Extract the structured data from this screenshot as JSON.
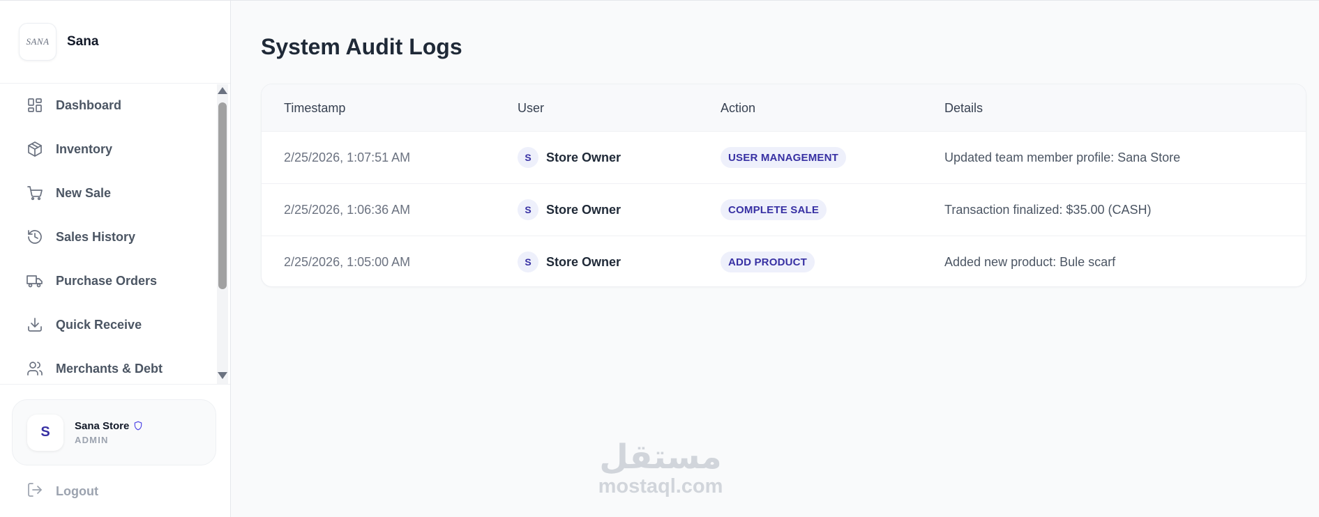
{
  "brand": {
    "name": "Sana",
    "logo_text": "SANA"
  },
  "sidebar": {
    "items": [
      {
        "label": "Dashboard",
        "icon": "grid-icon"
      },
      {
        "label": "Inventory",
        "icon": "box-icon"
      },
      {
        "label": "New Sale",
        "icon": "cart-icon"
      },
      {
        "label": "Sales History",
        "icon": "history-icon"
      },
      {
        "label": "Purchase Orders",
        "icon": "truck-icon"
      },
      {
        "label": "Quick Receive",
        "icon": "download-icon"
      },
      {
        "label": "Merchants & Debt",
        "icon": "users-icon"
      }
    ],
    "user": {
      "initial": "S",
      "name": "Sana Store",
      "role": "ADMIN",
      "badge_icon": "shield-icon"
    },
    "logout_label": "Logout"
  },
  "main": {
    "title": "System Audit Logs",
    "table": {
      "headers": [
        "Timestamp",
        "User",
        "Action",
        "Details"
      ],
      "rows": [
        {
          "timestamp": "2/25/2026, 1:07:51 AM",
          "user_initial": "S",
          "user": "Store Owner",
          "action": "USER MANAGEMENT",
          "details": "Updated team member profile: Sana Store"
        },
        {
          "timestamp": "2/25/2026, 1:06:36 AM",
          "user_initial": "S",
          "user": "Store Owner",
          "action": "COMPLETE SALE",
          "details": "Transaction finalized: $35.00 (CASH)"
        },
        {
          "timestamp": "2/25/2026, 1:05:00 AM",
          "user_initial": "S",
          "user": "Store Owner",
          "action": "ADD PRODUCT",
          "details": "Added new product: Bule scarf"
        }
      ]
    }
  },
  "watermark": {
    "arabic": "مستقل",
    "latin": "mostaql.com"
  },
  "colors": {
    "accent": "#3730a3",
    "badge_bg": "#eef0fb",
    "page_bg": "#f9fafb"
  }
}
